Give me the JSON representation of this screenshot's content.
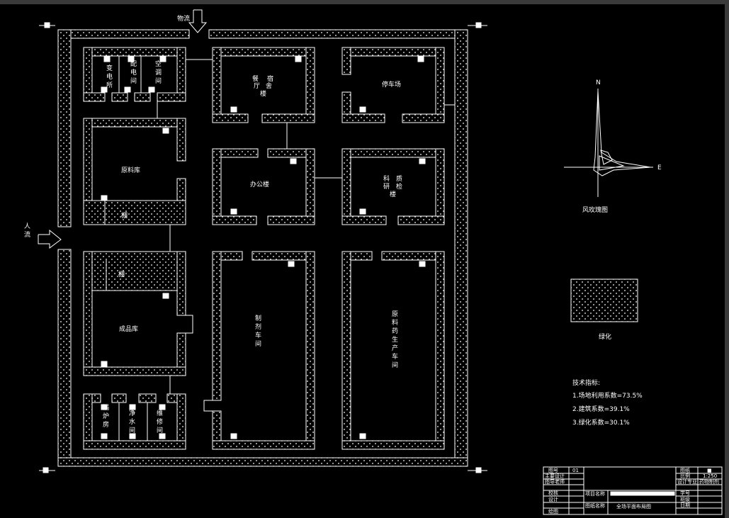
{
  "flows": {
    "goods": "物流",
    "people": "人流"
  },
  "buildings": {
    "substation": "变电所",
    "distribution": "配电间",
    "aircon": "空调间",
    "canteen": "餐厅",
    "dorm": "宿舍楼",
    "parking": "停车场",
    "raw_store": "原料库",
    "office": "办公楼",
    "qc": "质检科研楼",
    "finished_store": "成品库",
    "prep_workshop": "制剂车间",
    "api_workshop": "原料药生产车间",
    "boiler": "锅炉房",
    "water": "净水间",
    "repair": "维修间",
    "shelter1": "棚",
    "shelter2": "棚"
  },
  "legend": {
    "wind_title": "风玫瑰图",
    "north": "N",
    "east": "E",
    "green_label": "绿化"
  },
  "tech": {
    "title": "技术指标:",
    "items": [
      "1.场地利用系数=73.5%",
      "2.建筑系数=39.1%",
      "3.绿化系数=30.1%"
    ]
  },
  "title_block": {
    "drawing_no_label": "图号",
    "drawing_no": "01",
    "chief_label": "主要设计",
    "guide_label": "指导老师",
    "check_label": "校核",
    "design_label": "设计",
    "draw_label": "绘图",
    "project_label": "项目名称",
    "drawing_name_label": "图纸名称",
    "drawing_name": "全场平面布局图",
    "sheet_label": "图纸",
    "sheet_value": "■",
    "scale_label": "比例",
    "scale": "1:250",
    "major_label": "设计专业",
    "major": "药物制剂",
    "student_label": "学号",
    "class_label": "班级",
    "date_label": "日期"
  },
  "colors": {
    "line": "#ffffff",
    "bg": "#000000"
  }
}
